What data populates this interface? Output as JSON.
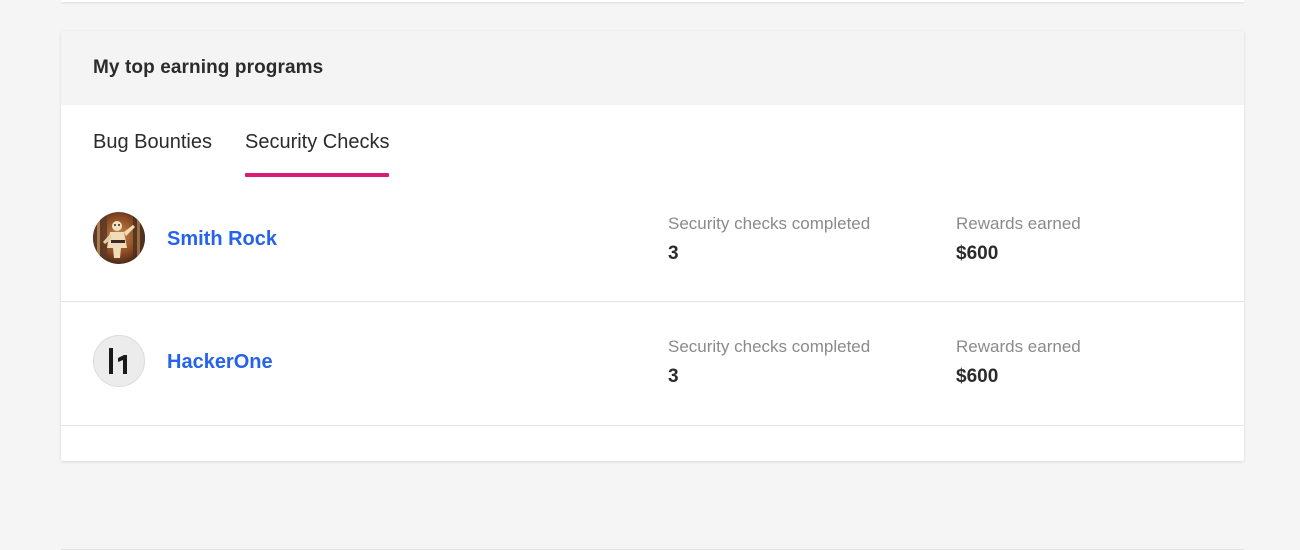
{
  "card": {
    "title": "My top earning programs"
  },
  "tabs": [
    {
      "label": "Bug Bounties",
      "active": false
    },
    {
      "label": "Security Checks",
      "active": true
    }
  ],
  "programs": [
    {
      "name": "Smith Rock",
      "avatar_icon": "smith-rock-logo",
      "checks_label": "Security checks completed",
      "checks_value": "3",
      "rewards_label": "Rewards earned",
      "rewards_value": "$600"
    },
    {
      "name": "HackerOne",
      "avatar_icon": "hackerone-logo",
      "checks_label": "Security checks completed",
      "checks_value": "3",
      "rewards_label": "Rewards earned",
      "rewards_value": "$600"
    }
  ],
  "colors": {
    "accent_tab_underline": "#d81b73",
    "link": "#2563eb",
    "header_bg": "#f4f4f4",
    "page_bg": "#f5f5f5"
  }
}
